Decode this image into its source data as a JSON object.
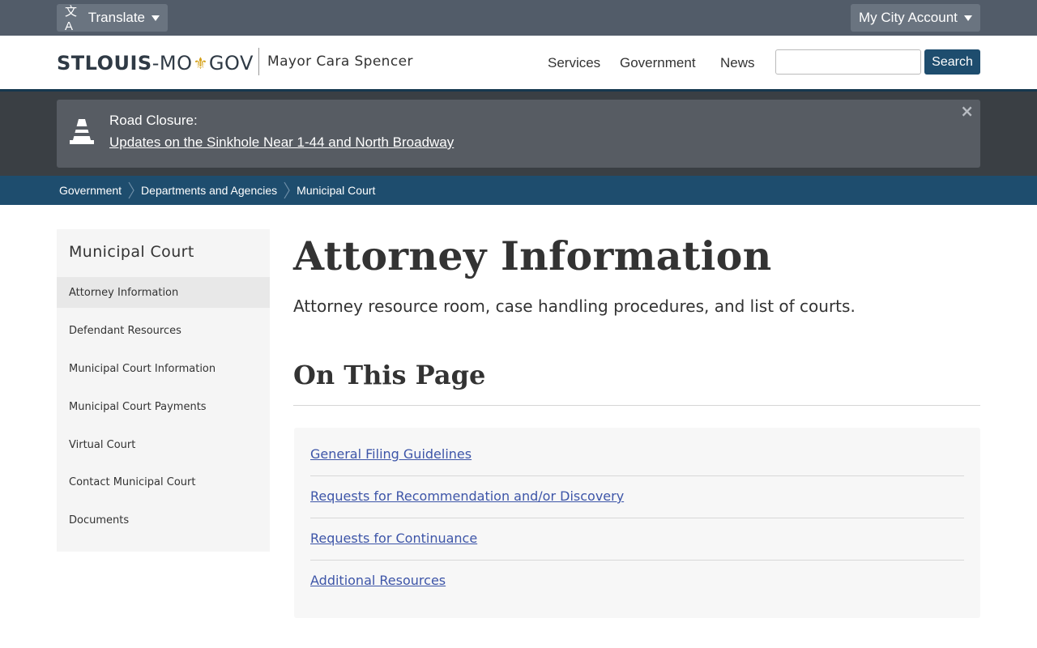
{
  "utility_bar": {
    "translate_label": "Translate",
    "translate_icon": "translate-icon",
    "account_label": "My City Account"
  },
  "header": {
    "logo_part1": "STLOUIS",
    "logo_dash": "-",
    "logo_part2": "MO",
    "logo_fleur": "⚜",
    "logo_part3": "GOV",
    "mayor": "Mayor Cara Spencer",
    "nav": [
      "Services",
      "Government",
      "News"
    ],
    "search_value": "",
    "search_button": "Search"
  },
  "alert": {
    "title": "Road Closure:",
    "link": "Updates on the Sinkhole Near 1-44 and North Broadway",
    "close": "×",
    "icon": "traffic-cone-icon"
  },
  "breadcrumb": [
    "Government",
    "Departments and Agencies",
    "Municipal Court"
  ],
  "sidebar": {
    "title": "Municipal Court",
    "items": [
      {
        "label": "Attorney Information",
        "active": true
      },
      {
        "label": "Defendant Resources"
      },
      {
        "label": "Municipal Court Information"
      },
      {
        "label": "Municipal Court Payments"
      },
      {
        "label": "Virtual Court"
      },
      {
        "label": "Contact Municipal Court"
      },
      {
        "label": "Documents"
      }
    ]
  },
  "main": {
    "title": "Attorney Information",
    "lede": "Attorney resource room, case handling procedures, and list of courts.",
    "section_title": "On This Page",
    "toc": [
      "General Filing Guidelines",
      "Requests for Recommendation and/or Discovery",
      "Requests for Continuance",
      "Additional Resources"
    ]
  },
  "colors": {
    "utility_bar": "#525c69",
    "brand_blue": "#1e4d6e",
    "link": "#3d55a8",
    "alert_band": "#3a3f44",
    "alert_box": "#575c63"
  }
}
